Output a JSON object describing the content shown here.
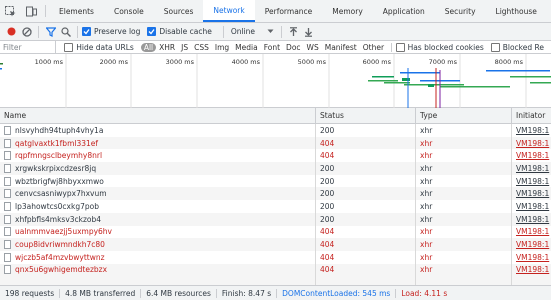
{
  "tabs": [
    {
      "label": "Elements",
      "active": false
    },
    {
      "label": "Console",
      "active": false
    },
    {
      "label": "Sources",
      "active": false
    },
    {
      "label": "Network",
      "active": true
    },
    {
      "label": "Performance",
      "active": false
    },
    {
      "label": "Memory",
      "active": false
    },
    {
      "label": "Application",
      "active": false
    },
    {
      "label": "Security",
      "active": false
    },
    {
      "label": "Lighthouse",
      "active": false
    }
  ],
  "toolbar": {
    "preserve_log": {
      "label": "Preserve log",
      "checked": true
    },
    "disable_cache": {
      "label": "Disable cache",
      "checked": true
    },
    "throttling": "Online"
  },
  "filter": {
    "placeholder": "Filter",
    "hide_data_urls": "Hide data URLs",
    "types": [
      "All",
      "XHR",
      "JS",
      "CSS",
      "Img",
      "Media",
      "Font",
      "Doc",
      "WS",
      "Manifest",
      "Other"
    ],
    "selected_type": "All",
    "has_blocked_cookies": "Has blocked cookies",
    "blocked_requests": "Blocked Re"
  },
  "overview": {
    "ticks": [
      "1000 ms",
      "2000 ms",
      "3000 ms",
      "4000 ms",
      "5000 ms",
      "6000 ms",
      "7000 ms",
      "8000 ms"
    ]
  },
  "table": {
    "headers": {
      "name": "Name",
      "status": "Status",
      "type": "Type",
      "initiator": "Initiator"
    },
    "rows": [
      {
        "name": "nlsvyhdh94tuph4vhy1a",
        "status": "200",
        "type": "xhr",
        "initiator": "VM198:1",
        "error": false
      },
      {
        "name": "qatglvaxtk1fbml331ef",
        "status": "404",
        "type": "xhr",
        "initiator": "VM198:1",
        "error": true
      },
      {
        "name": "rqpfmngsclbeymhy8nrl",
        "status": "404",
        "type": "xhr",
        "initiator": "VM198:1",
        "error": true
      },
      {
        "name": "xrgwkskrpixcdzesr8jq",
        "status": "200",
        "type": "xhr",
        "initiator": "VM198:1",
        "error": false
      },
      {
        "name": "wbztbrigfwj8hbyxxmwo",
        "status": "200",
        "type": "xhr",
        "initiator": "VM198:1",
        "error": false
      },
      {
        "name": "cenvcsasniwypx7hxvum",
        "status": "200",
        "type": "xhr",
        "initiator": "VM198:1",
        "error": false
      },
      {
        "name": "lp3ahowtcs0cxkg7pob",
        "status": "200",
        "type": "xhr",
        "initiator": "VM198:1",
        "error": false
      },
      {
        "name": "xhfpbfls4mksv3ckzob4",
        "status": "200",
        "type": "xhr",
        "initiator": "VM198:1",
        "error": false
      },
      {
        "name": "ualnmmvaezjj5uxmpy6hv",
        "status": "404",
        "type": "xhr",
        "initiator": "VM198:1",
        "error": true
      },
      {
        "name": "coup8idvriwmndkh7c80",
        "status": "404",
        "type": "xhr",
        "initiator": "VM198:1",
        "error": true
      },
      {
        "name": "wjczb5af4mzvbwyttwnz",
        "status": "404",
        "type": "xhr",
        "initiator": "VM198:1",
        "error": true
      },
      {
        "name": "qnx5u6gwhigemdtezbzx",
        "status": "404",
        "type": "xhr",
        "initiator": "VM198:1",
        "error": true
      }
    ]
  },
  "statusbar": {
    "requests": "198 requests",
    "transferred": "4.8 MB transferred",
    "resources": "6.4 MB resources",
    "finish": "Finish: 8.47 s",
    "dom_content_loaded": "DOMContentLoaded: 545 ms",
    "load": "Load: 4.11 s"
  },
  "colors": {
    "accent": "#1a73e8",
    "error": "#c5221f",
    "record": "#d93025"
  }
}
